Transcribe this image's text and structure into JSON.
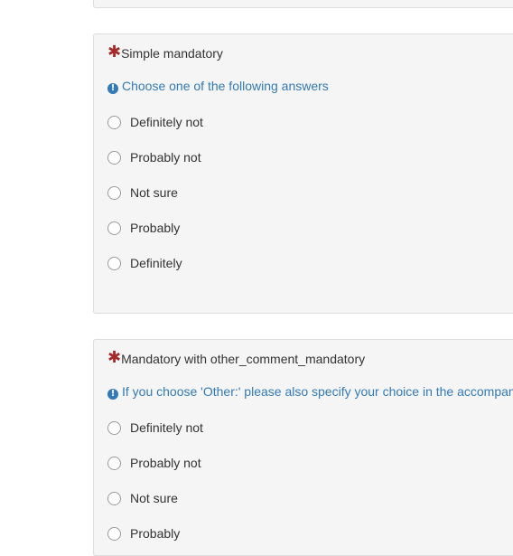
{
  "questions": [
    {
      "title": "Simple mandatory",
      "mandatory_marker": "✱",
      "help_text": "Choose one of the following answers",
      "answers": [
        "Definitely not",
        "Probably not",
        "Not sure",
        "Probably",
        "Definitely"
      ]
    },
    {
      "title": "Mandatory with other_comment_mandatory",
      "mandatory_marker": "✱",
      "help_text": "If you choose 'Other:' please also specify your choice in the accompan",
      "answers": [
        "Definitely not",
        "Probably not",
        "Not sure",
        "Probably"
      ]
    }
  ],
  "icons": {
    "info": "exclamation-circle-icon",
    "info_glyph": "!"
  },
  "colors": {
    "mandatory": "#a52a2a",
    "help_text": "#337ab7",
    "card_background": "#f5f5f5"
  }
}
